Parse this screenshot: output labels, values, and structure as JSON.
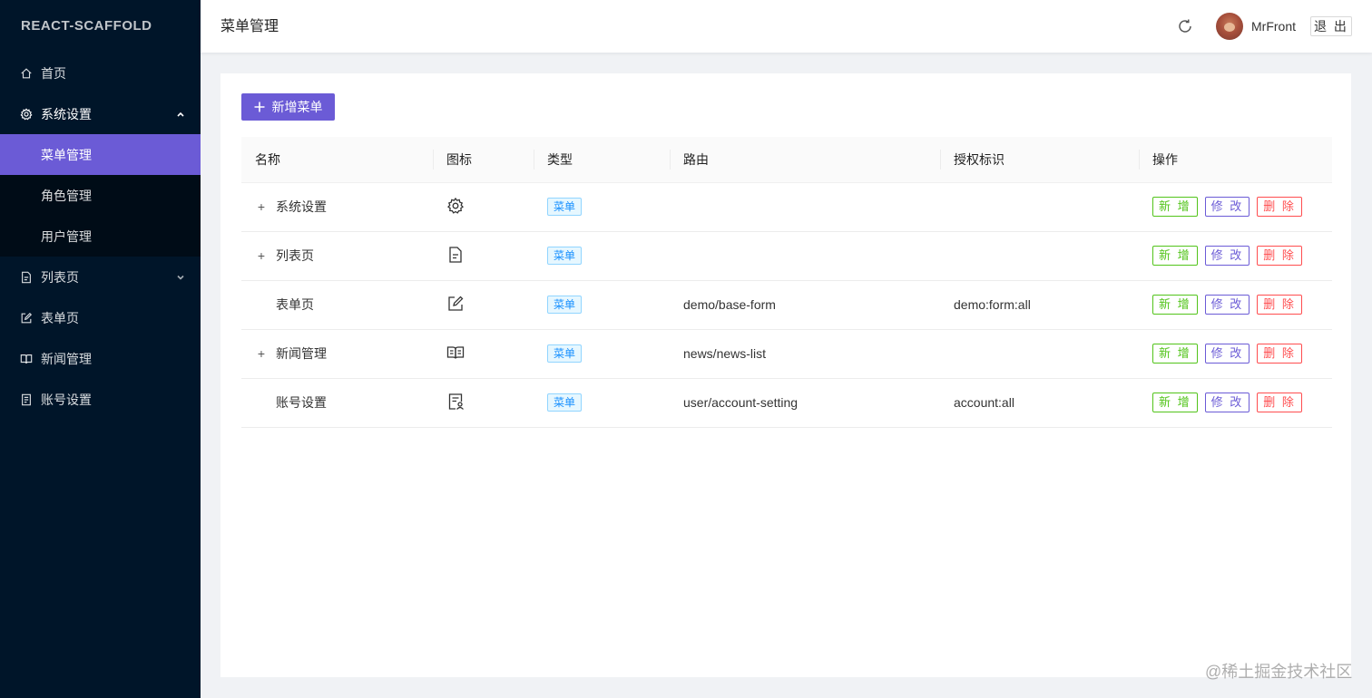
{
  "app": {
    "logo": "REACT-SCAFFOLD"
  },
  "sidebar": {
    "items": [
      {
        "label": "首页",
        "icon": "home-icon"
      },
      {
        "label": "系统设置",
        "icon": "gear-icon",
        "expanded": true,
        "children": [
          {
            "label": "菜单管理",
            "active": true
          },
          {
            "label": "角色管理"
          },
          {
            "label": "用户管理"
          }
        ]
      },
      {
        "label": "列表页",
        "icon": "file-text-icon",
        "expanded": false
      },
      {
        "label": "表单页",
        "icon": "edit-icon"
      },
      {
        "label": "新闻管理",
        "icon": "read-icon"
      },
      {
        "label": "账号设置",
        "icon": "account-book-icon"
      }
    ]
  },
  "header": {
    "title": "菜单管理",
    "username": "MrFront",
    "logout_label": "退 出"
  },
  "toolbar": {
    "add_label": "新增菜单"
  },
  "table": {
    "columns": [
      "名称",
      "图标",
      "类型",
      "路由",
      "授权标识",
      "操作"
    ],
    "rows": [
      {
        "name": "系统设置",
        "expandable": true,
        "icon": "setting-icon",
        "type": "菜单",
        "route": "",
        "auth": ""
      },
      {
        "name": "列表页",
        "expandable": true,
        "icon": "file-text-icon",
        "type": "菜单",
        "route": "",
        "auth": ""
      },
      {
        "name": "表单页",
        "expandable": false,
        "icon": "form-edit-icon",
        "type": "菜单",
        "route": "demo/base-form",
        "auth": "demo:form:all"
      },
      {
        "name": "新闻管理",
        "expandable": true,
        "icon": "read-icon",
        "type": "菜单",
        "route": "news/news-list",
        "auth": ""
      },
      {
        "name": "账号设置",
        "expandable": false,
        "icon": "solution-icon",
        "type": "菜单",
        "route": "user/account-setting",
        "auth": "account:all"
      }
    ],
    "actions": {
      "add": "新 增",
      "edit": "修 改",
      "delete": "删 除"
    }
  },
  "watermark": "@稀土掘金技术社区",
  "colors": {
    "primary": "#6b5bd6",
    "sider": "#001529",
    "tag_blue": "#1890ff",
    "green": "#52c41a",
    "red": "#ff4d4f"
  }
}
